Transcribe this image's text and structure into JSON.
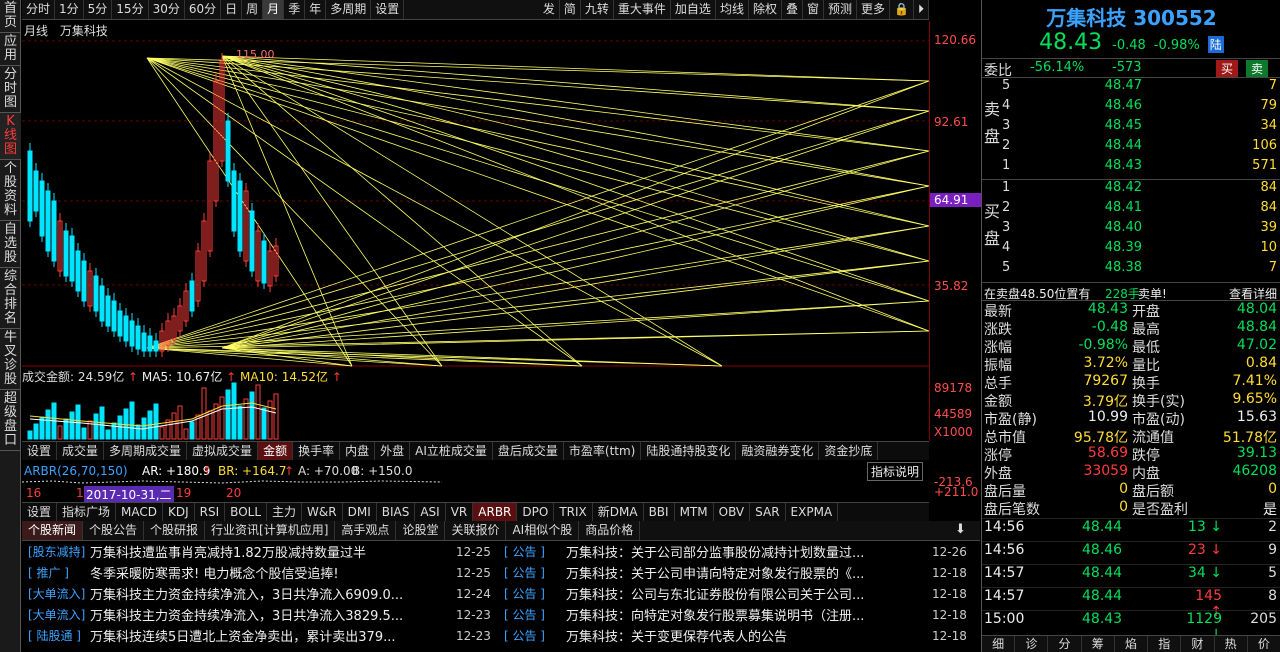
{
  "leftnav": [
    "首页",
    "应用",
    "分时图",
    "K线图",
    "个股资料",
    "自选股",
    "综合排名",
    "牛叉诊股",
    "超级盘口"
  ],
  "toolbar": {
    "periods": [
      "分时",
      "1分",
      "5分",
      "15分",
      "30分",
      "60分",
      "日",
      "周",
      "月",
      "季",
      "年",
      "多周期",
      "设置"
    ],
    "active_period": "月",
    "right_items": [
      "发",
      "简",
      "九转",
      "重大事件",
      "加自选",
      "均线",
      "除权",
      "叠",
      "窗",
      "预测",
      "更多"
    ]
  },
  "chart": {
    "period_label": "月线",
    "stock_label": "万集科技",
    "price_labels": [
      "120.66",
      "92.61",
      "64.91",
      "35.82"
    ],
    "high_label": "115.00",
    "volume_title": "成交金额: 24.59亿",
    "ma5_label": "MA5: 10.67亿",
    "ma10_label": "MA10: 14.52亿",
    "vol_axis": [
      "89178",
      "44589",
      "X1000"
    ]
  },
  "indicator_tabs": [
    "设置",
    "成交量",
    "多周期成交量",
    "虚拟成交量",
    "金额",
    "换手率",
    "内盘",
    "外盘",
    "AI立桩成交量",
    "盘后成交量",
    "市盈率(ttm)",
    "陆股通持股变化",
    "融资融券变化",
    "资金抄底"
  ],
  "active_indicator_tab": "金额",
  "arbr_line": {
    "name": "ARBR(26,70,150)",
    "ar": "AR: +180.9",
    "br": "BR: +164.7",
    "a": "A: +70.00",
    "b": "B: +150.0",
    "btn": "指标说明"
  },
  "arbr_axis": [
    "-213.6",
    "+211.0"
  ],
  "time_axis": {
    "a": "16",
    "b": "1",
    "date": "2017-10-31,二",
    "c": "19",
    "d": "20"
  },
  "indicator_tabs2": [
    "设置",
    "指标广场",
    "MACD",
    "KDJ",
    "RSI",
    "BOLL",
    "主力",
    "W&R",
    "DMI",
    "BIAS",
    "ASI",
    "VR",
    "ARBR",
    "DPO",
    "TRIX",
    "新DMA",
    "BBI",
    "MTM",
    "OBV",
    "SAR",
    "EXPMA"
  ],
  "active_indicator_tab2": "ARBR",
  "news_tabs": [
    "个股新闻",
    "个股公告",
    "个股研报",
    "行业资讯[计算机应用]",
    "高手观点",
    "论股堂",
    "关联报价",
    "AI相似个股",
    "商品价格"
  ],
  "news_left": [
    {
      "tag": "[股东减持]",
      "title": "万集科技遭监事肖亮减持1.82万股减持数量过半",
      "date": "12-25"
    },
    {
      "tag": "[ 推广 ]",
      "title": "冬季采暖防寒需求! 电力概念个股信受追捧!",
      "date": "12-25"
    },
    {
      "tag": "[大单流入]",
      "title": "万集科技主力资金持续净流入，3日共净流入6909.0...",
      "date": "12-24"
    },
    {
      "tag": "[大单流入]",
      "title": "万集科技主力资金持续净流入，3日共净流入3829.5...",
      "date": "12-23"
    },
    {
      "tag": "[ 陆股通 ]",
      "title": "万集科技连续5日遭北上资金净卖出，累计卖出379...",
      "date": "12-23"
    }
  ],
  "news_right": [
    {
      "tag": "[ 公告 ]",
      "title": "万集科技：关于公司部分监事股份减持计划数量过...",
      "date": "12-26"
    },
    {
      "tag": "[ 公告 ]",
      "title": "万集科技：关于公司申请向特定对象发行股票的《...",
      "date": "12-18"
    },
    {
      "tag": "[ 公告 ]",
      "title": "万集科技：公司与东北证券股份有限公司关于公司...",
      "date": "12-18"
    },
    {
      "tag": "[ 公告 ]",
      "title": "万集科技：向特定对象发行股票募集说明书（注册...",
      "date": "12-18"
    },
    {
      "tag": "[ 公告 ]",
      "title": "万集科技：关于变更保荐代表人的公告",
      "date": "12-18"
    }
  ],
  "quote": {
    "name": "万集科技 300552",
    "price": "48.43",
    "change": "-0.48",
    "pct": "-0.98%",
    "tag": "陆",
    "weibi_label": "委比",
    "weibi": "-56.14%",
    "weicha": "-573",
    "buy_btn": "买",
    "sell_btn": "卖"
  },
  "sell_book": [
    {
      "lv": "5",
      "px": "48.47",
      "vol": "7"
    },
    {
      "lv": "4",
      "px": "48.46",
      "vol": "79"
    },
    {
      "lv": "3",
      "px": "48.45",
      "vol": "34"
    },
    {
      "lv": "2",
      "px": "48.44",
      "vol": "106"
    },
    {
      "lv": "1",
      "px": "48.43",
      "vol": "571"
    }
  ],
  "buy_book": [
    {
      "lv": "1",
      "px": "48.42",
      "vol": "84"
    },
    {
      "lv": "2",
      "px": "48.41",
      "vol": "84"
    },
    {
      "lv": "3",
      "px": "48.40",
      "vol": "39"
    },
    {
      "lv": "4",
      "px": "48.39",
      "vol": "10"
    },
    {
      "lv": "5",
      "px": "48.38",
      "vol": "7"
    }
  ],
  "sell_label": "卖盘",
  "buy_label": "买盘",
  "alert": {
    "text": "在卖盘48.50位置有",
    "qty": "228手",
    "tail": "卖单!",
    "link": "查看详细"
  },
  "stats": [
    {
      "l1": "最新",
      "v1": "48.43",
      "c1": "g",
      "l2": "开盘",
      "v2": "48.04",
      "c2": "g"
    },
    {
      "l1": "涨跌",
      "v1": "-0.48",
      "c1": "g",
      "l2": "最高",
      "v2": "48.84",
      "c2": "g"
    },
    {
      "l1": "涨幅",
      "v1": "-0.98%",
      "c1": "g",
      "l2": "最低",
      "v2": "47.02",
      "c2": "g"
    },
    {
      "l1": "振幅",
      "v1": "3.72%",
      "c1": "y",
      "l2": "量比",
      "v2": "0.84",
      "c2": "y"
    },
    {
      "l1": "总手",
      "v1": "79267",
      "c1": "y",
      "l2": "换手",
      "v2": "7.41%",
      "c2": "y"
    },
    {
      "l1": "金额",
      "v1": "3.79亿",
      "c1": "y",
      "l2": "换手(实)",
      "v2": "9.65%",
      "c2": "y"
    },
    {
      "l1": "市盈(静)",
      "v1": "10.99",
      "c1": "w",
      "l2": "市盈(动)",
      "v2": "15.63",
      "c2": "w"
    },
    {
      "l1": "总市值",
      "v1": "95.78亿",
      "c1": "y",
      "l2": "流通值",
      "v2": "51.78亿",
      "c2": "y"
    },
    {
      "l1": "涨停",
      "v1": "58.69",
      "c1": "r",
      "l2": "跌停",
      "v2": "39.13",
      "c2": "g"
    },
    {
      "l1": "外盘",
      "v1": "33059",
      "c1": "r",
      "l2": "内盘",
      "v2": "46208",
      "c2": "g"
    },
    {
      "l1": "盘后量",
      "v1": "0",
      "c1": "y",
      "l2": "盘后额",
      "v2": "0",
      "c2": "y"
    },
    {
      "l1": "盘后笔数",
      "v1": "0",
      "c1": "y",
      "l2": "是否盈利",
      "v2": "是",
      "c2": "w"
    }
  ],
  "ticks": [
    {
      "t": "14:56",
      "p": "48.44",
      "v": "13",
      "c": "g",
      "dir": "↓",
      "n": "2"
    },
    {
      "t": "14:56",
      "p": "48.46",
      "v": "23",
      "c": "r",
      "dir": "↓",
      "n": "9"
    },
    {
      "t": "14:57",
      "p": "48.44",
      "v": "34",
      "c": "g",
      "dir": "↓",
      "n": "5"
    },
    {
      "t": "14:57",
      "p": "48.44",
      "v": "145",
      "c": "r",
      "dir": "↑",
      "n": "8"
    },
    {
      "t": "15:00",
      "p": "48.43",
      "v": "1129",
      "c": "g",
      "dir": "↓",
      "n": "205"
    }
  ],
  "bottom_tabs": [
    "细",
    "诊",
    "分",
    "筹",
    "焰",
    "指",
    "财",
    "热",
    "价"
  ]
}
